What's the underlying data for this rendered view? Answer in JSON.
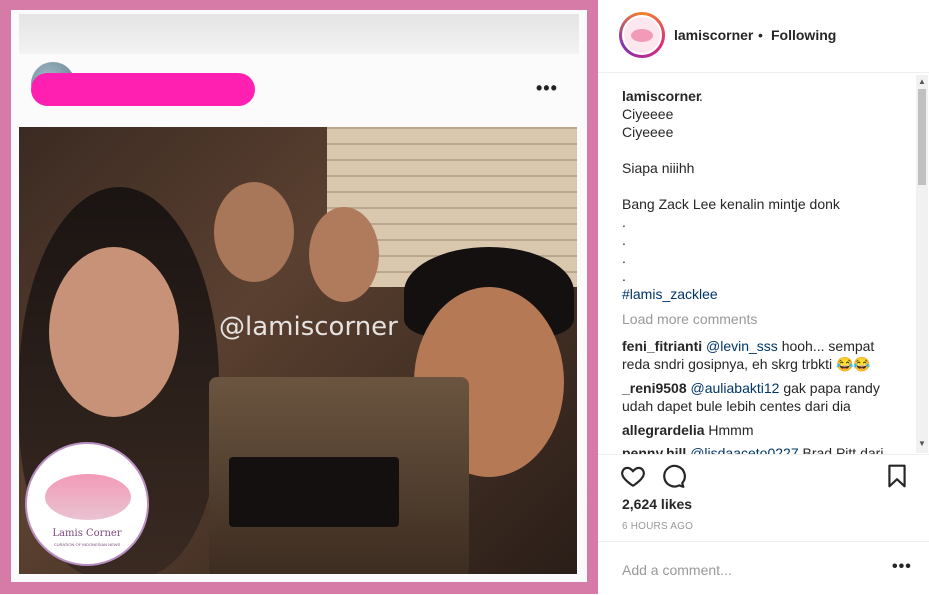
{
  "header": {
    "username": "lamiscorner",
    "separator": "•",
    "follow_status": "Following"
  },
  "photo": {
    "watermark": "@lamiscorner",
    "logo_title": "Lamis Corner",
    "logo_sub": "CURATION OF INDONESIAN NEWS"
  },
  "caption": {
    "username": "lamiscorner",
    "trail": ".",
    "lines": [
      "Ciyeeee",
      "Ciyeeee",
      "Siapa niiihh",
      "Bang Zack Lee kenalin mintje donk",
      ".",
      ".",
      ".",
      "."
    ],
    "hashtag": "#lamis_zacklee"
  },
  "load_more": "Load more comments",
  "comments": [
    {
      "user": "feni_fitrianti",
      "mention": "@levin_sss",
      "text": " hooh... sempat reda sndri gosipnya, eh skrg trbkti 😂😂"
    },
    {
      "user": "_reni9508",
      "mention": "@auliabakti12",
      "text": " gak papa randy udah dapet bule lebih centes dari dia"
    },
    {
      "user": "allegrardelia",
      "mention": "",
      "text": "Hmmm"
    },
    {
      "user": "penny.hill",
      "mention": "@lisdaaceto0227",
      "text": " Brad Pitt dari"
    }
  ],
  "actions": {
    "like_icon": "heart-icon",
    "comment_icon": "comment-icon",
    "save_icon": "bookmark-icon"
  },
  "likes": "2,624 likes",
  "timestamp": "6 HOURS AGO",
  "add_comment": {
    "placeholder": "Add a comment...",
    "more": "•••"
  },
  "post_menu": "•••"
}
